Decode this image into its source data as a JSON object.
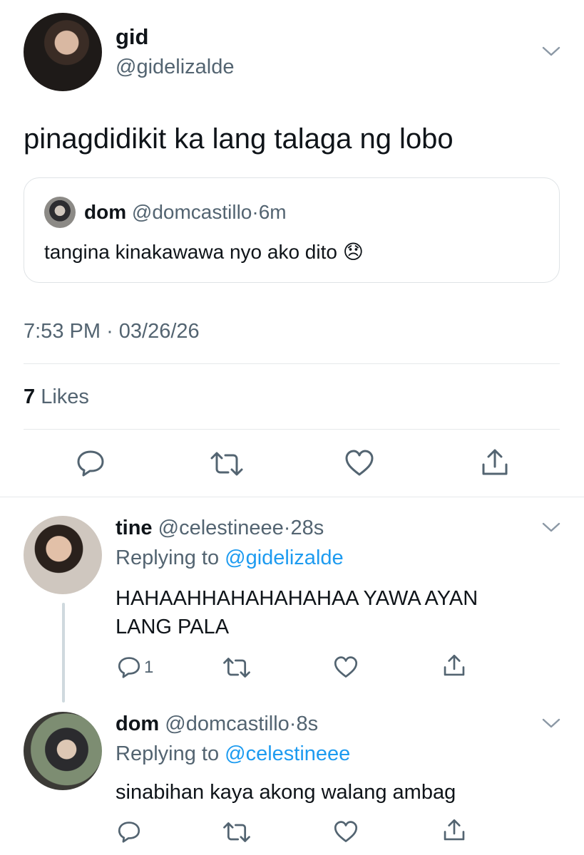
{
  "main_tweet": {
    "display_name": "gid",
    "handle": "@gidelizalde",
    "text": "pinagdidikit ka lang talaga ng lobo",
    "quote": {
      "display_name": "dom",
      "handle": "@domcastillo",
      "separator": "·",
      "time": "6m",
      "text": "tangina kinakawawa nyo ako dito",
      "emoji": "😞"
    },
    "time": "7:53 PM",
    "separator": "·",
    "date": "03/26/26",
    "likes_count": "7",
    "likes_label": "Likes"
  },
  "replies": [
    {
      "display_name": "tine",
      "handle": "@celestineee",
      "separator": "·",
      "time": "28s",
      "replying_prefix": "Replying to",
      "replying_handle": "@gidelizalde",
      "text_line1": "HAHAAHHAHAHAHAHAA YAWA AYAN",
      "text_line2": "LANG PALA",
      "reply_count": "1"
    },
    {
      "display_name": "dom",
      "handle": "@domcastillo",
      "separator": "·",
      "time": "8s",
      "replying_prefix": "Replying to",
      "replying_handle": "@celestineee",
      "text_line1": "sinabihan kaya akong walang ambag"
    }
  ],
  "icons": [
    "reply-icon",
    "retweet-icon",
    "like-icon",
    "share-icon",
    "chevron-down-icon"
  ],
  "colors": {
    "link": "#1d9bf0",
    "muted": "#536471",
    "text": "#0f1419",
    "divider": "#e6e9eb"
  }
}
